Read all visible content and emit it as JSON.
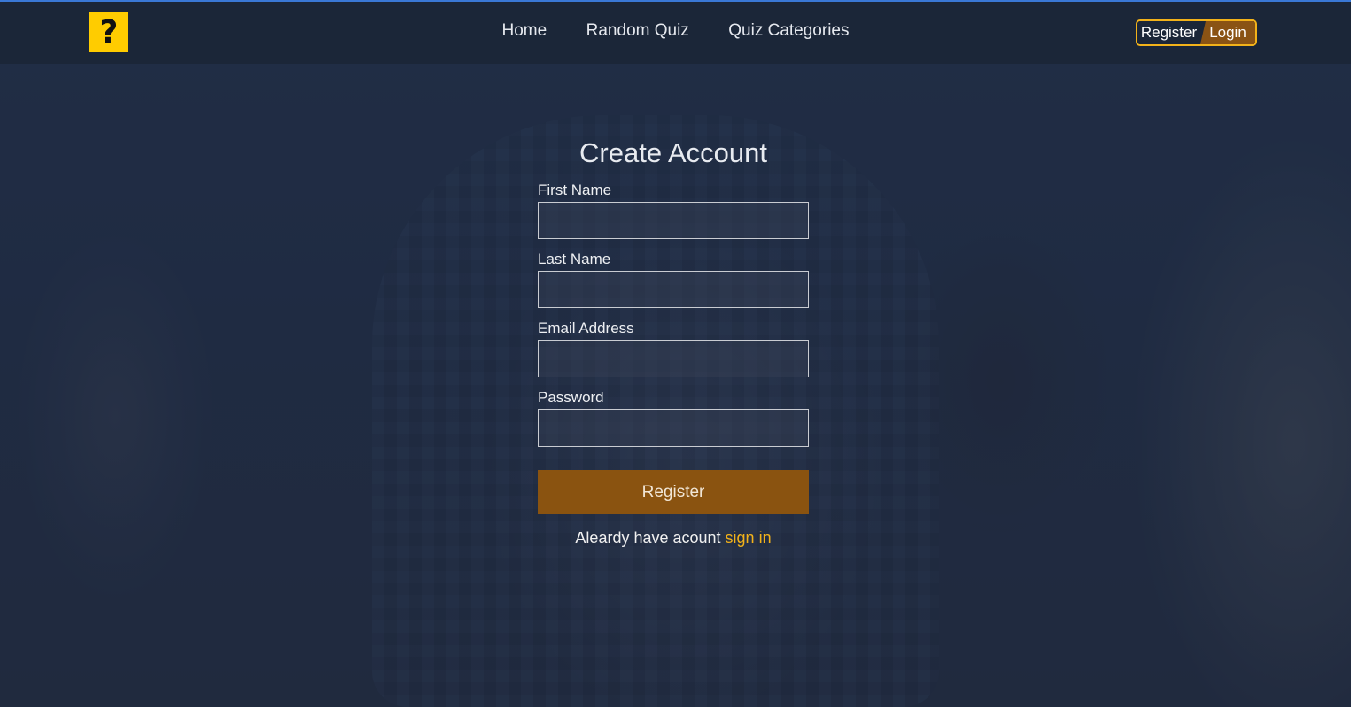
{
  "nav": {
    "logo_glyph": "?",
    "links": [
      "Home",
      "Random Quiz",
      "Quiz Categories"
    ],
    "register_label": "Register",
    "login_label": "Login"
  },
  "form": {
    "title": "Create Account",
    "fields": [
      {
        "label": "First Name",
        "value": ""
      },
      {
        "label": "Last Name",
        "value": ""
      },
      {
        "label": "Email Address",
        "value": ""
      },
      {
        "label": "Password",
        "value": ""
      }
    ],
    "submit_label": "Register",
    "signin_prompt": "Aleardy have acount",
    "signin_link": "sign in"
  },
  "colors": {
    "accent": "#f2b21a",
    "button": "#8a5310",
    "navbar": "#1b2638",
    "logo": "#ffcc00"
  }
}
